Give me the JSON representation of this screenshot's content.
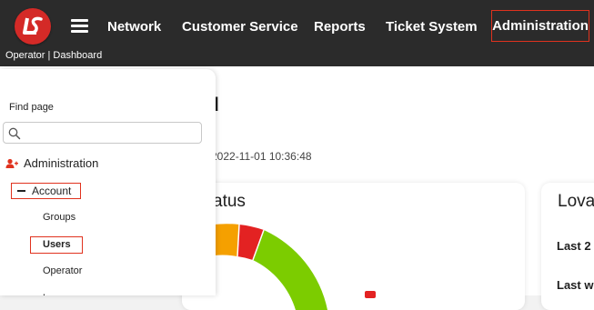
{
  "header": {
    "brand_caption": "Operator | Dashboard",
    "nav": [
      {
        "label": "Network"
      },
      {
        "label": "Customer Service"
      },
      {
        "label": "Reports"
      },
      {
        "label": "Ticket System"
      },
      {
        "label": "Administration",
        "highlighted": true
      }
    ]
  },
  "main": {
    "title_fragment": "d",
    "timestamp": "2022-11-01 10:36:48",
    "status_card": {
      "title_fragment": "atus"
    },
    "side_card": {
      "title_fragment": "Lova",
      "rows": [
        "Last 2",
        "Last w"
      ]
    }
  },
  "sidebar": {
    "find_label": "Find page",
    "search": {
      "value": "",
      "placeholder": ""
    },
    "tree": {
      "root": {
        "label": "Administration",
        "icon": "add-user-icon"
      },
      "group": {
        "label": "Account",
        "expanded": true,
        "highlighted": true
      },
      "items": [
        {
          "label": "Groups"
        },
        {
          "label": "Users",
          "highlighted": true
        },
        {
          "label": "Operator"
        }
      ],
      "cut_off_item": "L"
    }
  },
  "colors": {
    "topbar": "#2b2b2b",
    "brand_red": "#d42a27",
    "highlight_border": "#e0321e",
    "donut_orange": "#f5a000",
    "donut_red": "#e32222",
    "donut_green": "#7ccc00"
  }
}
